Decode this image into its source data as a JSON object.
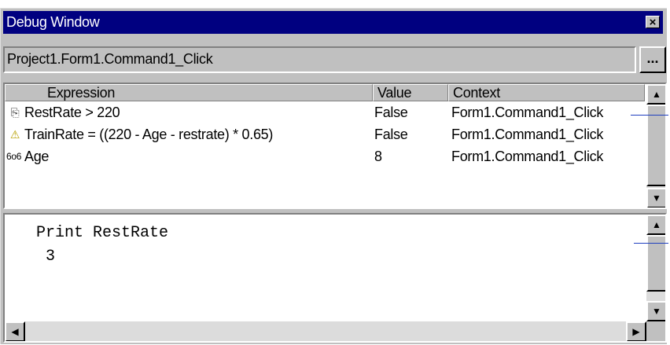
{
  "window": {
    "title": "Debug Window"
  },
  "procedure": {
    "text": "Project1.Form1.Command1_Click",
    "browse_label": "..."
  },
  "watch": {
    "headers": [
      "Expression",
      "Value",
      "Context"
    ],
    "rows": [
      {
        "icon": "break-when-true-icon",
        "glyph": "⎘",
        "expression": "RestRate > 220",
        "value": "False",
        "context": "Form1.Command1_Click"
      },
      {
        "icon": "break-when-changed-icon",
        "glyph": "⚠",
        "expression": "TrainRate = ((220 - Age - restrate) * 0.65)",
        "value": "False",
        "context": "Form1.Command1_Click"
      },
      {
        "icon": "watch-expression-icon",
        "glyph": "6o6",
        "expression": "Age",
        "value": "8",
        "context": "Form1.Command1_Click"
      }
    ]
  },
  "immediate": {
    "lines": [
      "Print RestRate",
      " 3"
    ]
  },
  "glyphs": {
    "up": "▲",
    "down": "▼",
    "left": "◀",
    "right": "▶",
    "close": "×"
  }
}
